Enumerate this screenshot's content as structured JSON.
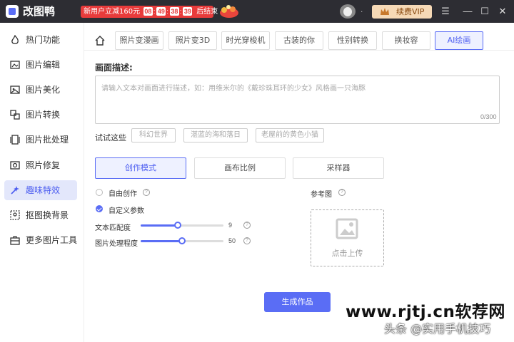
{
  "app": {
    "title": "改图鸭",
    "promo_text": "新用户立减160元",
    "countdown": [
      "08",
      "49",
      "38",
      "39"
    ],
    "countdown_sep": ":",
    "promo_end": "后结束",
    "user_dot": ".",
    "vip_label": "续费VIP"
  },
  "window": {
    "menu": "☰",
    "minimize": "—",
    "maximize": "☐",
    "close": "✕"
  },
  "sidebar": {
    "items": [
      {
        "label": "热门功能",
        "icon": "flame-icon"
      },
      {
        "label": "图片编辑",
        "icon": "image-edit-icon"
      },
      {
        "label": "图片美化",
        "icon": "image-beautify-icon"
      },
      {
        "label": "图片转换",
        "icon": "convert-icon"
      },
      {
        "label": "图片批处理",
        "icon": "batch-icon"
      },
      {
        "label": "照片修复",
        "icon": "photo-repair-icon"
      },
      {
        "label": "趣味特效",
        "icon": "magic-icon",
        "active": true
      },
      {
        "label": "抠图换背景",
        "icon": "cutout-icon"
      },
      {
        "label": "更多图片工具",
        "icon": "toolbox-icon"
      }
    ]
  },
  "tabs": [
    {
      "label": "照片变漫画"
    },
    {
      "label": "照片变3D"
    },
    {
      "label": "时光穿梭机"
    },
    {
      "label": "古装的你"
    },
    {
      "label": "性别转换"
    },
    {
      "label": "换妆容"
    },
    {
      "label": "AI绘画",
      "active": true
    }
  ],
  "prompt": {
    "label": "画面描述:",
    "placeholder": "请输入文本对画面进行描述，如：用维米尔的《戴珍珠耳环的少女》风格画一只海豚",
    "counter": "0/300"
  },
  "try": {
    "label": "试试这些",
    "chips": [
      "科幻世界",
      "湛蓝的海和落日",
      "老屋前的黄色小猫"
    ]
  },
  "modes": [
    {
      "label": "创作模式",
      "active": true
    },
    {
      "label": "画布比例"
    },
    {
      "label": "采样器"
    }
  ],
  "options": {
    "free_label": "自由创作",
    "custom_label": "自定义参数"
  },
  "sliders": [
    {
      "label": "文本匹配度",
      "value": 9,
      "min": 0,
      "max": 20
    },
    {
      "label": "图片处理程度",
      "value": 50,
      "min": 0,
      "max": 100
    }
  ],
  "reference": {
    "label": "参考图",
    "upload_text": "点击上传"
  },
  "generate_label": "生成作品",
  "help_glyph": "?",
  "watermark": {
    "line1": "www.rjtj.cn软荐网",
    "line2": "头条 @实用手机技巧"
  },
  "colors": {
    "accent": "#5a6df5",
    "promo": "#e83b3b",
    "titlebar": "#2d2d33",
    "vip": "#f6d9b6"
  }
}
